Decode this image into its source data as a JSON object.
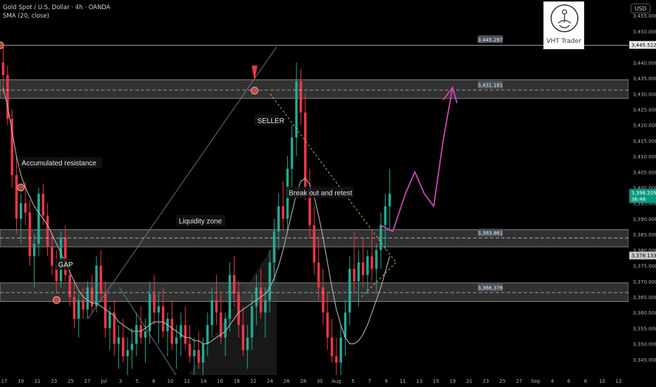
{
  "header": {
    "symbol": "Gold Spot / U.S. Dollar · 4h · OANDA",
    "indicator": "SMA (20, close)"
  },
  "logo": {
    "text": "VHT Trader"
  },
  "currency": "USD",
  "colors": {
    "background": "#000000",
    "up": "#22ab94",
    "down": "#f23645",
    "sma": "#b5b5b5",
    "projection": "#d147b8",
    "zone": "#5a5a5a",
    "current_price": "#089981"
  },
  "chart_data": {
    "type": "candlestick",
    "title": "Gold Spot / U.S. Dollar · 4h · OANDA",
    "ylim": [
      3340,
      3460
    ],
    "y_ticks": [
      3345,
      3350,
      3355,
      3360,
      3365,
      3370,
      3375,
      3380,
      3385,
      3390,
      3395,
      3400,
      3405,
      3410,
      3415,
      3420,
      3425,
      3430,
      3435,
      3440,
      3445,
      3450,
      3455
    ],
    "y_tick_labels": [
      "3,345.000",
      "3,350.000",
      "3,355.000",
      "3,360.000",
      "3,365.000",
      "3,370.000",
      "3,375.000",
      "3,380.000",
      "3,385.000",
      "3,390.000",
      "3,395.000",
      "3,400.000",
      "3,405.000",
      "3,410.000",
      "3,415.000",
      "3,420.000",
      "3,425.000",
      "3,430.000",
      "3,435.000",
      "3,440.000",
      "3,445.000",
      "3,450.000",
      "3,455.000"
    ],
    "x_tick_labels": [
      "17",
      "19",
      "21",
      "23",
      "25",
      "27",
      "Jul",
      "3",
      "5",
      "8",
      "10",
      "12",
      "14",
      "16",
      "18",
      "22",
      "24",
      "26",
      "28",
      "30",
      "Aug",
      "5",
      "7",
      "9",
      "11",
      "13",
      "15",
      "19",
      "21",
      "23",
      "25",
      "27",
      "Sep",
      "4",
      "6",
      "8",
      "10",
      "12"
    ],
    "horizontal_levels": [
      {
        "value": 3445.522,
        "label": "3,445.522",
        "style": "solid"
      },
      {
        "value": 3445.297,
        "label": "3,445.297",
        "style": "callout"
      },
      {
        "value": 3431.181,
        "label": "3,431.181",
        "style": "dashed"
      },
      {
        "value": 3383.861,
        "label": "3,383.861",
        "style": "dashed"
      },
      {
        "value": 3366.376,
        "label": "3,366.376",
        "style": "dashed"
      }
    ],
    "zones": [
      {
        "from": 3428.5,
        "to": 3434.5
      },
      {
        "from": 3381.0,
        "to": 3386.5
      },
      {
        "from": 3363.5,
        "to": 3369.5
      }
    ],
    "current_price": {
      "value": 3398.205,
      "label": "3,398.205",
      "countdown": "36:48"
    },
    "sma_price": {
      "value": 3378.133,
      "label": "3,378.133"
    },
    "annotations": [
      "Accumulated resistance",
      "GAP",
      "Liquidity zone",
      "SELLER",
      "Break out and retest"
    ],
    "candles": [
      [
        3440,
        3445,
        3430,
        3436
      ],
      [
        3436,
        3439,
        3420,
        3422
      ],
      [
        3422,
        3425,
        3400,
        3404
      ],
      [
        3404,
        3410,
        3385,
        3390
      ],
      [
        3390,
        3398,
        3382,
        3395
      ],
      [
        3395,
        3402,
        3388,
        3392
      ],
      [
        3392,
        3396,
        3375,
        3378
      ],
      [
        3378,
        3385,
        3368,
        3382
      ],
      [
        3382,
        3400,
        3378,
        3398
      ],
      [
        3398,
        3401,
        3388,
        3391
      ],
      [
        3391,
        3395,
        3378,
        3381
      ],
      [
        3381,
        3385,
        3372,
        3375
      ],
      [
        3375,
        3380,
        3366,
        3370
      ],
      [
        3370,
        3386,
        3368,
        3384
      ],
      [
        3384,
        3388,
        3370,
        3372
      ],
      [
        3372,
        3376,
        3362,
        3365
      ],
      [
        3365,
        3370,
        3355,
        3358
      ],
      [
        3358,
        3366,
        3352,
        3364
      ],
      [
        3364,
        3368,
        3358,
        3361
      ],
      [
        3361,
        3370,
        3358,
        3368
      ],
      [
        3368,
        3372,
        3360,
        3362
      ],
      [
        3362,
        3378,
        3360,
        3375
      ],
      [
        3375,
        3380,
        3364,
        3366
      ],
      [
        3366,
        3370,
        3352,
        3355
      ],
      [
        3355,
        3362,
        3348,
        3360
      ],
      [
        3360,
        3364,
        3346,
        3350
      ],
      [
        3350,
        3356,
        3342,
        3352
      ],
      [
        3352,
        3358,
        3344,
        3346
      ],
      [
        3346,
        3352,
        3340,
        3348
      ],
      [
        3348,
        3355,
        3342,
        3350
      ],
      [
        3350,
        3360,
        3346,
        3356
      ],
      [
        3356,
        3362,
        3350,
        3352
      ],
      [
        3352,
        3358,
        3344,
        3354
      ],
      [
        3354,
        3370,
        3350,
        3366
      ],
      [
        3366,
        3372,
        3356,
        3360
      ],
      [
        3360,
        3366,
        3350,
        3362
      ],
      [
        3362,
        3368,
        3352,
        3354
      ],
      [
        3354,
        3360,
        3346,
        3358
      ],
      [
        3358,
        3364,
        3348,
        3350
      ],
      [
        3350,
        3356,
        3342,
        3352
      ],
      [
        3352,
        3360,
        3346,
        3356
      ],
      [
        3356,
        3362,
        3348,
        3350
      ],
      [
        3350,
        3356,
        3344,
        3346
      ],
      [
        3346,
        3352,
        3340,
        3348
      ],
      [
        3348,
        3354,
        3342,
        3344
      ],
      [
        3344,
        3352,
        3340,
        3350
      ],
      [
        3350,
        3360,
        3346,
        3356
      ],
      [
        3356,
        3368,
        3352,
        3364
      ],
      [
        3364,
        3372,
        3356,
        3360
      ],
      [
        3360,
        3366,
        3350,
        3352
      ],
      [
        3352,
        3360,
        3346,
        3358
      ],
      [
        3358,
        3376,
        3354,
        3372
      ],
      [
        3372,
        3378,
        3362,
        3366
      ],
      [
        3366,
        3370,
        3352,
        3356
      ],
      [
        3356,
        3362,
        3346,
        3348
      ],
      [
        3348,
        3356,
        3342,
        3352
      ],
      [
        3352,
        3366,
        3348,
        3362
      ],
      [
        3362,
        3372,
        3356,
        3368
      ],
      [
        3368,
        3374,
        3358,
        3360
      ],
      [
        3360,
        3368,
        3352,
        3364
      ],
      [
        3364,
        3380,
        3360,
        3376
      ],
      [
        3376,
        3390,
        3370,
        3386
      ],
      [
        3386,
        3398,
        3380,
        3394
      ],
      [
        3394,
        3402,
        3386,
        3390
      ],
      [
        3390,
        3410,
        3386,
        3406
      ],
      [
        3406,
        3420,
        3400,
        3416
      ],
      [
        3416,
        3440,
        3410,
        3434
      ],
      [
        3434,
        3438,
        3420,
        3424
      ],
      [
        3424,
        3430,
        3396,
        3400
      ],
      [
        3400,
        3406,
        3384,
        3388
      ],
      [
        3388,
        3394,
        3372,
        3376
      ],
      [
        3376,
        3384,
        3364,
        3368
      ],
      [
        3368,
        3374,
        3356,
        3360
      ],
      [
        3360,
        3366,
        3348,
        3352
      ],
      [
        3352,
        3358,
        3344,
        3346
      ],
      [
        3346,
        3352,
        3340,
        3344
      ],
      [
        3344,
        3356,
        3340,
        3352
      ],
      [
        3352,
        3364,
        3346,
        3360
      ],
      [
        3360,
        3378,
        3356,
        3374
      ],
      [
        3374,
        3386,
        3366,
        3370
      ],
      [
        3370,
        3380,
        3362,
        3376
      ],
      [
        3376,
        3384,
        3368,
        3372
      ],
      [
        3372,
        3380,
        3366,
        3378
      ],
      [
        3378,
        3386,
        3370,
        3374
      ],
      [
        3374,
        3382,
        3366,
        3380
      ],
      [
        3380,
        3392,
        3374,
        3388
      ],
      [
        3388,
        3398,
        3380,
        3394
      ],
      [
        3394,
        3406,
        3386,
        3398
      ]
    ],
    "sma_values": [
      3432,
      3426,
      3418,
      3410,
      3404,
      3400,
      3397,
      3394,
      3392,
      3390,
      3388,
      3385,
      3382,
      3379,
      3376,
      3373,
      3370,
      3367,
      3365,
      3364,
      3363,
      3363,
      3362,
      3361,
      3360,
      3359,
      3357,
      3356,
      3355,
      3354,
      3354,
      3354,
      3355,
      3356,
      3357,
      3357,
      3357,
      3356,
      3355,
      3354,
      3353,
      3352,
      3352,
      3351,
      3351,
      3350,
      3350,
      3351,
      3352,
      3353,
      3354,
      3356,
      3358,
      3360,
      3361,
      3362,
      3363,
      3364,
      3365,
      3366,
      3368,
      3371,
      3375,
      3380,
      3386,
      3392,
      3398,
      3402,
      3403,
      3401,
      3397,
      3391,
      3384,
      3376,
      3368,
      3361,
      3356,
      3352,
      3350,
      3350,
      3351,
      3353,
      3356,
      3360,
      3364,
      3368,
      3373,
      3378
    ]
  }
}
